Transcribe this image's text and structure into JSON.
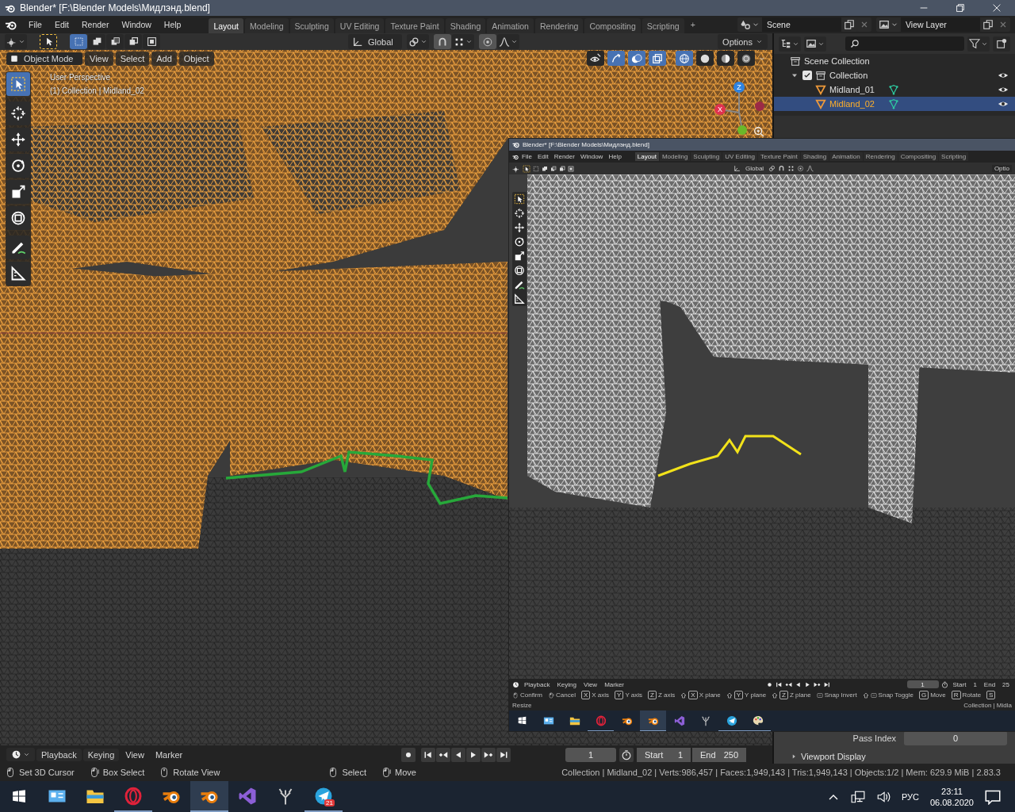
{
  "window": {
    "title": "Blender* [F:\\Blender Models\\Мидлэнд.blend]"
  },
  "menu": [
    "File",
    "Edit",
    "Render",
    "Window",
    "Help"
  ],
  "workspaces": [
    {
      "label": "Layout",
      "selected": true
    },
    {
      "label": "Modeling",
      "selected": false
    },
    {
      "label": "Sculpting",
      "selected": false
    },
    {
      "label": "UV Editing",
      "selected": false
    },
    {
      "label": "Texture Paint",
      "selected": false
    },
    {
      "label": "Shading",
      "selected": false
    },
    {
      "label": "Animation",
      "selected": false
    },
    {
      "label": "Rendering",
      "selected": false
    },
    {
      "label": "Compositing",
      "selected": false
    },
    {
      "label": "Scripting",
      "selected": false
    }
  ],
  "add_workspace": "+",
  "scene": "Scene",
  "view_layer": "View Layer",
  "tool_header": {
    "select_modes": [
      {
        "kind": "new",
        "selected": true
      },
      {
        "kind": "extend",
        "selected": false
      },
      {
        "kind": "subtract",
        "selected": false
      },
      {
        "kind": "difference",
        "selected": false
      },
      {
        "kind": "intersect",
        "selected": false
      }
    ],
    "orientation": "Global",
    "options": "Options"
  },
  "viewport_header": {
    "mode": "Object Mode",
    "menus": [
      "View",
      "Select",
      "Add",
      "Object"
    ],
    "toggles": [
      {
        "kind": "visibility",
        "selected": false
      },
      {
        "kind": "gizmo",
        "selected": true
      },
      {
        "kind": "overlay",
        "selected": true
      },
      {
        "kind": "xray",
        "selected": true
      },
      {
        "kind": "wireframe",
        "selected": true
      },
      {
        "kind": "solid",
        "selected": false
      },
      {
        "kind": "material",
        "selected": false
      },
      {
        "kind": "rendered",
        "selected": false
      }
    ]
  },
  "viewport": {
    "perspective": "User Perspective",
    "context": "(1) Collection | Midland_02",
    "gizmo_x": "X",
    "gizmo_z": "Z"
  },
  "tools": [
    {
      "kind": "select",
      "selected": true
    },
    {
      "kind": "cursor",
      "selected": false
    },
    {
      "kind": "move",
      "selected": false
    },
    {
      "kind": "rotate",
      "selected": false
    },
    {
      "kind": "scale",
      "selected": false
    },
    {
      "kind": "transform",
      "selected": false
    },
    {
      "kind": "annotate",
      "selected": false
    },
    {
      "kind": "measure",
      "selected": false
    }
  ],
  "outliner": {
    "root": "Scene Collection",
    "collections": [
      {
        "label": "Collection",
        "checked": true,
        "expanded": true,
        "children": [
          {
            "label": "Midland_01",
            "selected": false
          },
          {
            "label": "Midland_02",
            "selected": true
          }
        ]
      }
    ]
  },
  "properties": {
    "pass_index_label": "Pass Index",
    "pass_index": "0",
    "panel": {
      "label": "Viewport Display",
      "expanded": false
    }
  },
  "timeline": {
    "menus": [
      "Playback",
      "Keying",
      "View",
      "Marker"
    ],
    "frame": "1",
    "start_label": "Start",
    "start": "1",
    "end_label": "End",
    "end": "250"
  },
  "status_bar": {
    "hints": [
      {
        "kind": "click",
        "label": "Set 3D Cursor"
      },
      {
        "kind": "drag",
        "label": "Box Select"
      },
      {
        "kind": "middle",
        "label": "Rotate View"
      },
      {
        "kind": "click",
        "label": "Select"
      },
      {
        "kind": "drag",
        "label": "Move"
      }
    ],
    "stats": "Collection | Midland_02 | Verts:986,457 | Faces:1,949,143 | Tris:1,949,143 | Objects:1/2 | Mem: 629.9 MiB | 2.83.3"
  },
  "taskbar": {
    "apps": [
      {
        "kind": "contacts",
        "running": false,
        "selected": false
      },
      {
        "kind": "folder",
        "running": false,
        "selected": false
      },
      {
        "kind": "opera",
        "running": true,
        "selected": false
      },
      {
        "kind": "blender",
        "running": false,
        "selected": false
      },
      {
        "kind": "blender",
        "running": true,
        "selected": true
      },
      {
        "kind": "studio",
        "running": false,
        "selected": false
      },
      {
        "kind": "tree",
        "running": false,
        "selected": false
      },
      {
        "kind": "telegram",
        "running": true,
        "selected": false,
        "badge": "21"
      }
    ],
    "language": "РУС",
    "time": "23:11",
    "date": "06.08.2020"
  },
  "inset": {
    "title": "Blender* [F:\\Blender Models\\Мидлэнд.blend]",
    "menu": [
      "File",
      "Edit",
      "Render",
      "Window",
      "Help"
    ],
    "workspaces": [
      {
        "label": "Layout",
        "selected": true
      },
      {
        "label": "Modeling",
        "selected": false
      },
      {
        "label": "Sculpting",
        "selected": false
      },
      {
        "label": "UV Editing",
        "selected": false
      },
      {
        "label": "Texture Paint",
        "selected": false
      },
      {
        "label": "Shading",
        "selected": false
      },
      {
        "label": "Animation",
        "selected": false
      },
      {
        "label": "Rendering",
        "selected": false
      },
      {
        "label": "Compositing",
        "selected": false
      },
      {
        "label": "Scripting",
        "selected": false
      }
    ],
    "orientation": "Global",
    "options": "Optio",
    "timeline": {
      "menus": [
        "Playback",
        "Keying",
        "View",
        "Marker"
      ],
      "frame": "1",
      "start_label": "Start",
      "start": "1",
      "end_label": "End",
      "end": "25"
    },
    "status": [
      {
        "kind": "click",
        "label": "Confirm"
      },
      {
        "kind": "drag",
        "label": "Cancel"
      },
      {
        "kind": "key",
        "key": "X",
        "label": "X axis"
      },
      {
        "kind": "key",
        "key": "Y",
        "label": "Y axis"
      },
      {
        "kind": "key",
        "key": "Z",
        "label": "Z axis"
      },
      {
        "kind": "shift-key",
        "key": "X",
        "label": "X plane"
      },
      {
        "kind": "shift-key",
        "key": "Y",
        "label": "Y plane"
      },
      {
        "kind": "shift-key",
        "key": "Z",
        "label": "Z plane"
      },
      {
        "kind": "ctrl",
        "label": "Snap Invert"
      },
      {
        "kind": "shift-ctrl",
        "label": "Snap Toggle"
      },
      {
        "kind": "key",
        "key": "G",
        "label": "Move"
      },
      {
        "kind": "key",
        "key": "R",
        "label": "Rotate"
      },
      {
        "kind": "key",
        "key": "S",
        "label": "Resize"
      }
    ],
    "stats": "Collection | Midla",
    "apps": [
      {
        "kind": "contacts",
        "running": false,
        "selected": false
      },
      {
        "kind": "folder",
        "running": false,
        "selected": false
      },
      {
        "kind": "opera",
        "running": true,
        "selected": false
      },
      {
        "kind": "blender",
        "running": false,
        "selected": false
      },
      {
        "kind": "blender",
        "running": true,
        "selected": true
      },
      {
        "kind": "studio",
        "running": false,
        "selected": false
      },
      {
        "kind": "tree",
        "running": false,
        "selected": false
      },
      {
        "kind": "telegram",
        "running": true,
        "selected": false
      },
      {
        "kind": "palette",
        "running": true,
        "selected": false
      }
    ]
  }
}
